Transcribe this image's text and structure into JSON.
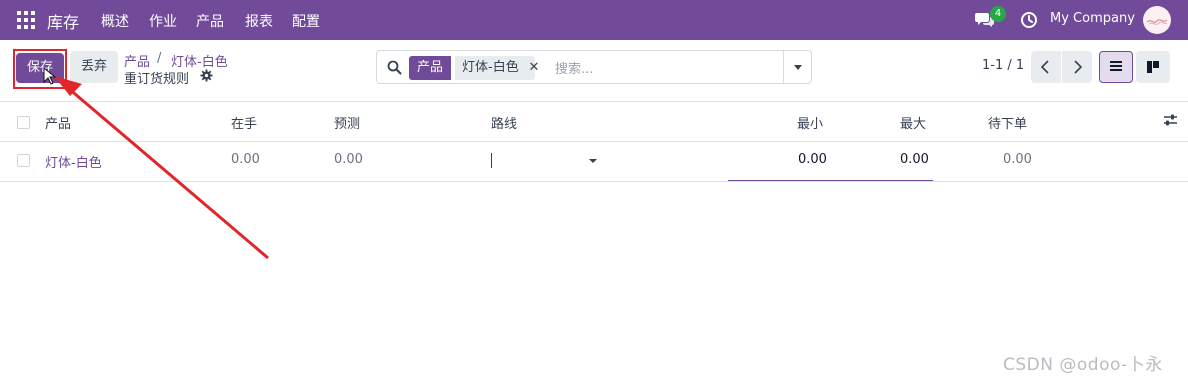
{
  "navbar": {
    "brand": "库存",
    "menu": [
      "概述",
      "作业",
      "产品",
      "报表",
      "配置"
    ],
    "chat_badge": "4",
    "company": "My Company",
    "bg_color": "#714B9A"
  },
  "control_panel": {
    "save_label": "保存",
    "discard_label": "丢弃",
    "breadcrumb_parent": "产品",
    "breadcrumb_sep": "/",
    "breadcrumb_current": "灯体-白色",
    "title": "重订货规则"
  },
  "search": {
    "facet_label": "产品",
    "facet_value": "灯体-白色",
    "placeholder": "搜索..."
  },
  "pager": {
    "text": "1-1 / 1"
  },
  "table": {
    "columns": [
      "产品",
      "在手",
      "预测",
      "路线",
      "最小",
      "最大",
      "待下单"
    ],
    "rows": [
      {
        "product": "灯体-白色",
        "on_hand": "0.00",
        "forecast": "0.00",
        "route": "",
        "min": "0.00",
        "max": "0.00",
        "to_order": "0.00"
      }
    ]
  },
  "annotation": {
    "color": "#e0262b"
  },
  "watermark": "CSDN @odoo-卜永",
  "icons": [
    "apps-grid-icon",
    "chat-icon",
    "clock-icon",
    "gear-icon",
    "search-icon",
    "close-icon",
    "chevron-left-icon",
    "chevron-right-icon",
    "list-view-icon",
    "kanban-view-icon",
    "optional-columns-icon",
    "caret-down-icon"
  ]
}
